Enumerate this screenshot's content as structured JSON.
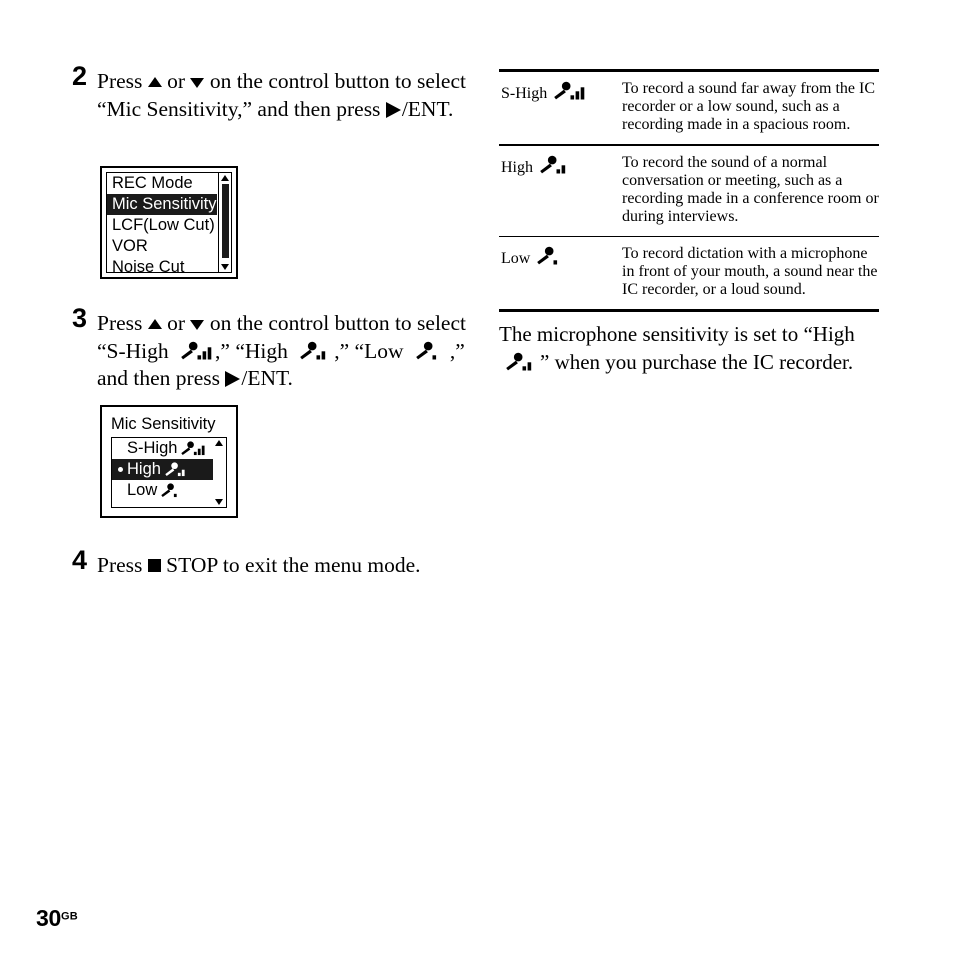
{
  "page": {
    "number": "30",
    "suffix": "GB"
  },
  "steps": [
    {
      "number": "2",
      "text_a": "Press ",
      "text_b": " or ",
      "text_c": " on the control button to select “Mic Sensitivity,” and then press ",
      "text_d": "/ENT."
    },
    {
      "number": "3",
      "text_a": "Press ",
      "text_b": " or ",
      "text_c": " on the control button to select “S-High ",
      "text_d": ",” “High ",
      "text_e": ",” “Low ",
      "text_f": ",” and then press ",
      "text_g": "/ENT."
    },
    {
      "number": "4",
      "text_a": "Press ",
      "text_b": " STOP to exit the menu mode."
    }
  ],
  "lcd_menu": {
    "rows": [
      {
        "label": "REC Mode",
        "selected": false
      },
      {
        "label": "Mic Sensitivity",
        "selected": true
      },
      {
        "label": "LCF(Low Cut)",
        "selected": false
      },
      {
        "label": "VOR",
        "selected": false
      },
      {
        "label": "Noise Cut",
        "selected": false
      }
    ]
  },
  "lcd_sensitivity": {
    "title": "Mic Sensitivity",
    "rows": [
      {
        "label": "S-High",
        "bars": 3,
        "selected": false,
        "bullet": false
      },
      {
        "label": "High",
        "bars": 2,
        "selected": true,
        "bullet": true
      },
      {
        "label": "Low",
        "bars": 1,
        "selected": false,
        "bullet": false
      }
    ]
  },
  "spec_table": {
    "rows": [
      {
        "term": "S-High",
        "bars": 3,
        "description": "To record a sound far away from the IC recorder or a low sound, such as a recording made in a spacious room."
      },
      {
        "term": "High",
        "bars": 2,
        "description": "To record the sound of a normal conversation or meeting, such as a recording made in a conference room or during interviews."
      },
      {
        "term": "Low",
        "bars": 1,
        "description": "To record dictation with a microphone in front of your mouth, a sound near the IC recorder, or a loud sound."
      }
    ]
  },
  "note": {
    "text_a": "The microphone sensitivity is set to “High ",
    "text_b": "” when you purchase the IC recorder."
  },
  "icons": {
    "up_triangle": "triangle-up-icon",
    "down_triangle": "triangle-down-icon",
    "play_triangle": "play-triangle-icon",
    "stop_square": "stop-square-icon",
    "mic_sensitivity": "mic-sensitivity-icon"
  }
}
